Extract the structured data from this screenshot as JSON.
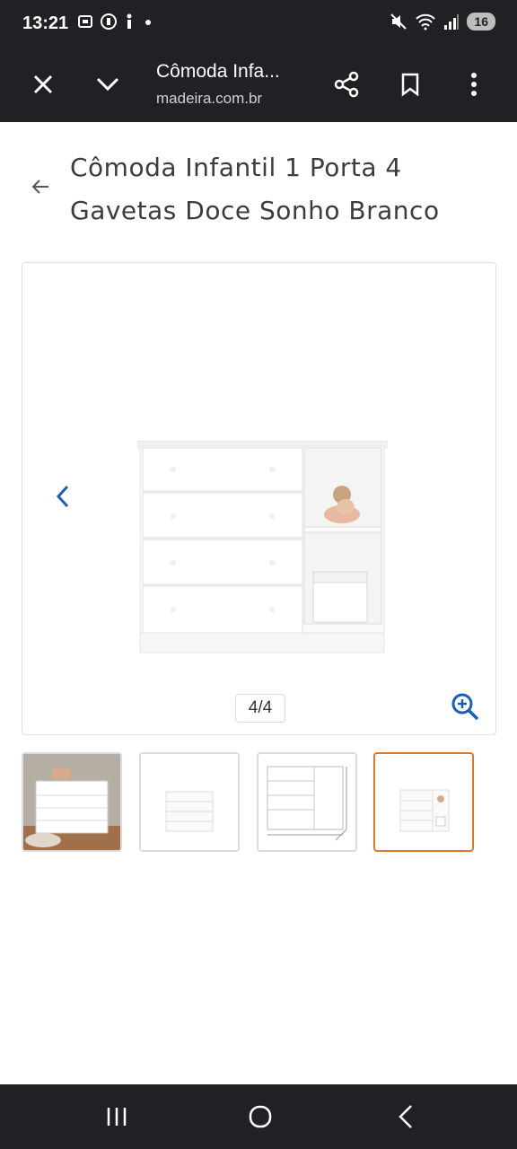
{
  "status_bar": {
    "time": "13:21",
    "battery": "16"
  },
  "toolbar": {
    "title": "Cômoda Infa...",
    "url": "madeira.com.br"
  },
  "product": {
    "title": "Cômoda Infantil 1 Porta 4 Gavetas Doce Sonho Branco"
  },
  "gallery": {
    "counter": "4/4",
    "current_index": 4,
    "total": 4
  },
  "thumbnails": [
    {
      "name": "room-scene-thumbnail",
      "active": false
    },
    {
      "name": "drawers-front-thumbnail",
      "active": false
    },
    {
      "name": "dimensions-thumbnail",
      "active": false
    },
    {
      "name": "dresser-with-shelf-thumbnail",
      "active": true
    }
  ],
  "colors": {
    "chrome": "#202124",
    "accent_blue": "#1a5fb4",
    "active_thumb_border": "#d97a2b"
  }
}
